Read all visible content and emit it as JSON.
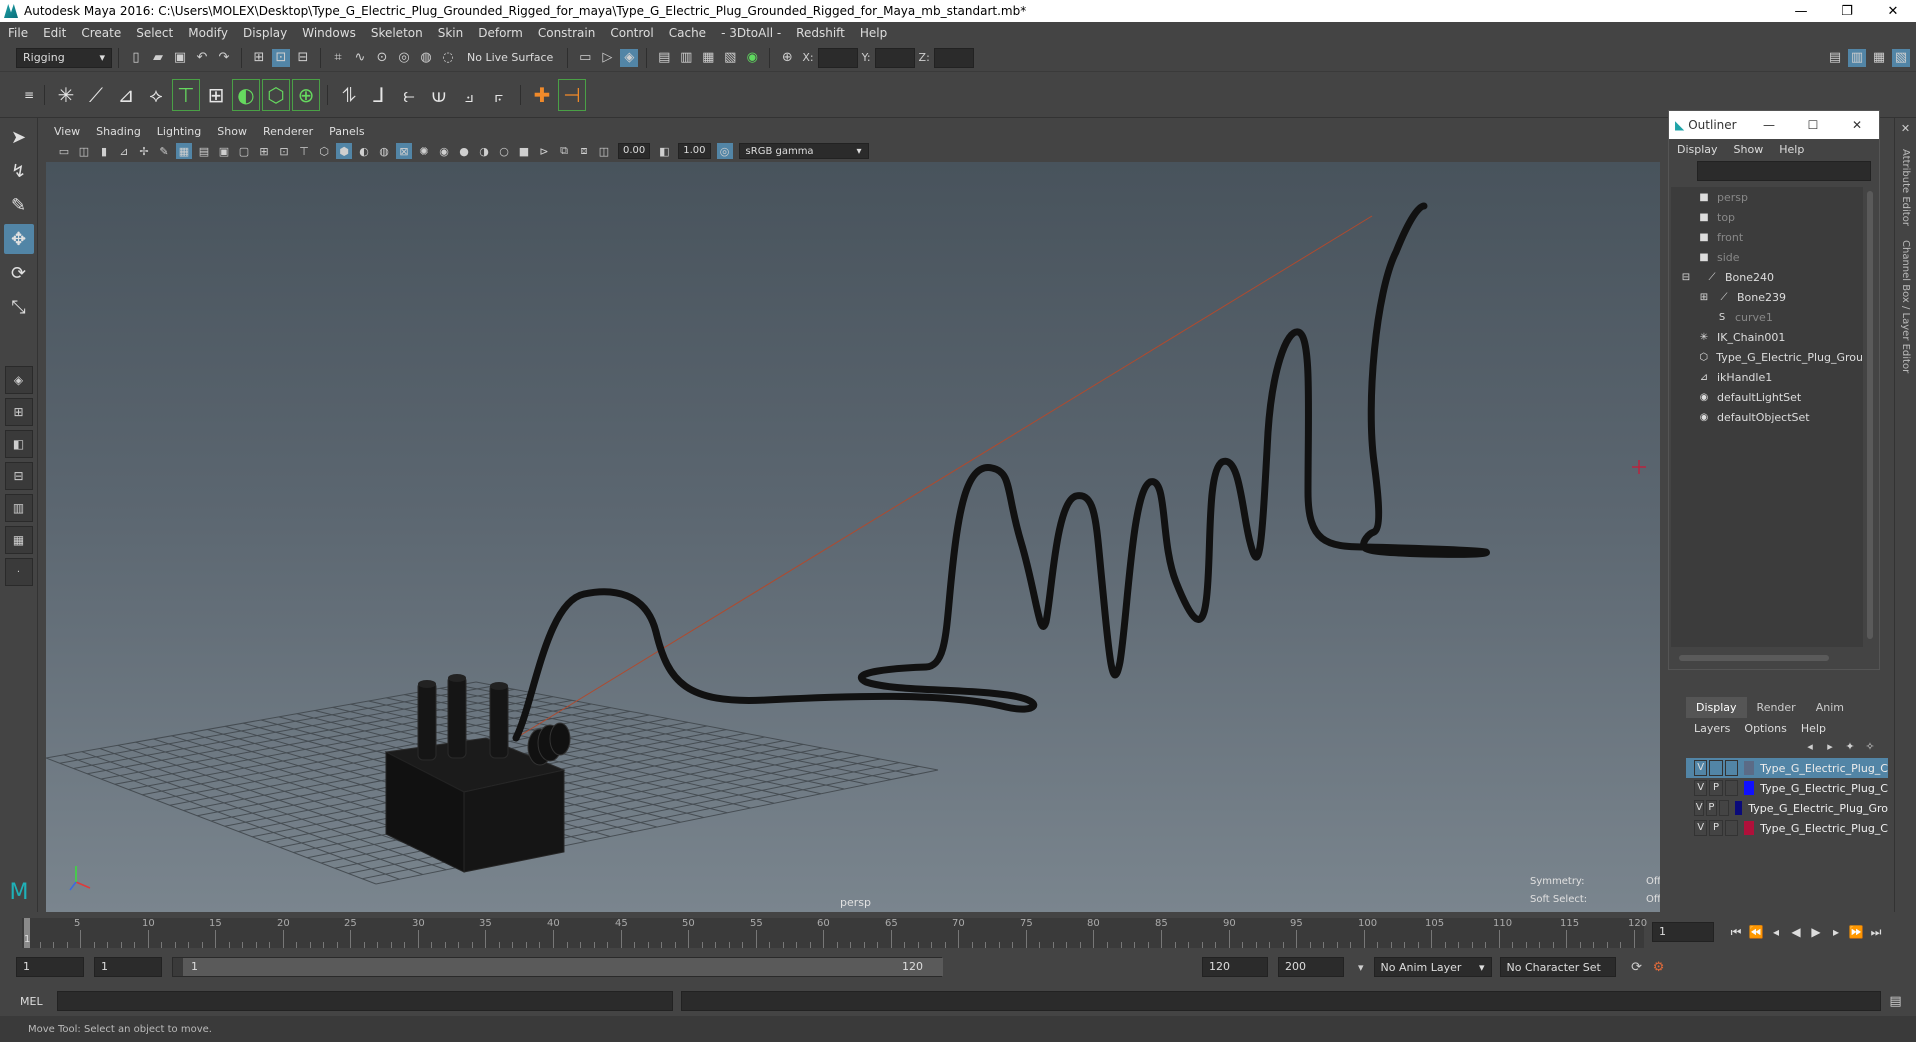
{
  "window": {
    "title": "Autodesk Maya 2016: C:\\Users\\MOLEX\\Desktop\\Type_G_Electric_Plug_Grounded_Rigged_for_maya\\Type_G_Electric_Plug_Grounded_Rigged_for_Maya_mb_standart.mb*",
    "minimize": "—",
    "restore": "❐",
    "close": "✕"
  },
  "menubar": [
    "File",
    "Edit",
    "Create",
    "Select",
    "Modify",
    "Display",
    "Windows",
    "Skeleton",
    "Skin",
    "Deform",
    "Constrain",
    "Control",
    "Cache",
    "- 3DtoAll -",
    "Redshift",
    "Help"
  ],
  "statusline": {
    "menuset": "Rigging",
    "live_surface": "No Live Surface",
    "x_label": "X:",
    "y_label": "Y:",
    "z_label": "Z:"
  },
  "viewport": {
    "menu": [
      "View",
      "Shading",
      "Lighting",
      "Show",
      "Renderer",
      "Panels"
    ],
    "exposure": "0.00",
    "gamma": "1.00",
    "color_space": "sRGB gamma",
    "camera": "persp",
    "symmetry_label": "Symmetry:",
    "symmetry_value": "Off",
    "soft_select_label": "Soft Select:",
    "soft_select_value": "Off"
  },
  "outliner": {
    "title": "Outliner",
    "menu": [
      "Display",
      "Show",
      "Help"
    ],
    "items": [
      {
        "label": "persp",
        "icon": "camera-icon",
        "indent": 1,
        "dim": true
      },
      {
        "label": "top",
        "icon": "camera-icon",
        "indent": 1,
        "dim": true
      },
      {
        "label": "front",
        "icon": "camera-icon",
        "indent": 1,
        "dim": true
      },
      {
        "label": "side",
        "icon": "camera-icon",
        "indent": 1,
        "dim": true
      },
      {
        "label": "Bone240",
        "icon": "joint-icon",
        "indent": 1,
        "dim": false
      },
      {
        "label": "Bone239",
        "icon": "joint-icon",
        "indent": 2,
        "dim": false
      },
      {
        "label": "curve1",
        "icon": "curve-icon",
        "indent": 2,
        "dim": true
      },
      {
        "label": "IK_Chain001",
        "icon": "ik-chain-icon",
        "indent": 1,
        "dim": false
      },
      {
        "label": "Type_G_Electric_Plug_Grou",
        "icon": "mesh-icon",
        "indent": 1,
        "dim": false
      },
      {
        "label": "ikHandle1",
        "icon": "ik-handle-icon",
        "indent": 1,
        "dim": false
      },
      {
        "label": "defaultLightSet",
        "icon": "set-icon",
        "indent": 1,
        "dim": false
      },
      {
        "label": "defaultObjectSet",
        "icon": "set-icon",
        "indent": 1,
        "dim": false
      }
    ]
  },
  "layers": {
    "tabs": [
      "Display",
      "Render",
      "Anim"
    ],
    "menu": [
      "Layers",
      "Options",
      "Help"
    ],
    "rows": [
      {
        "v": "V",
        "p": "",
        "color": "#5b6b86",
        "name": "Type_G_Electric_Plug_C",
        "selected": true
      },
      {
        "v": "V",
        "p": "P",
        "color": "#1010ff",
        "name": "Type_G_Electric_Plug_C",
        "selected": false
      },
      {
        "v": "V",
        "p": "P",
        "color": "#0a0a7a",
        "name": "Type_G_Electric_Plug_Gro",
        "selected": false
      },
      {
        "v": "V",
        "p": "P",
        "color": "#b0103a",
        "name": "Type_G_Electric_Plug_C",
        "selected": false
      }
    ]
  },
  "timeline": {
    "ticks": [
      "5",
      "10",
      "15",
      "20",
      "25",
      "30",
      "35",
      "40",
      "45",
      "50",
      "55",
      "60",
      "65",
      "70",
      "75",
      "80",
      "85",
      "90",
      "95",
      "100",
      "105",
      "110",
      "115",
      "120"
    ],
    "start_tick": "1",
    "current_frame": "1"
  },
  "range": {
    "start": "1",
    "playback_start": "1",
    "range_start": "1",
    "range_end": "120",
    "playback_end": "120",
    "end": "200",
    "anim_layer": "No Anim Layer",
    "character_set": "No Character Set"
  },
  "cmdline": {
    "label": "MEL"
  },
  "helpline": {
    "text": "Move Tool: Select an object to move."
  },
  "right_strip": {
    "tab1": "Attribute Editor",
    "tab2": "Channel Box / Layer Editor"
  }
}
